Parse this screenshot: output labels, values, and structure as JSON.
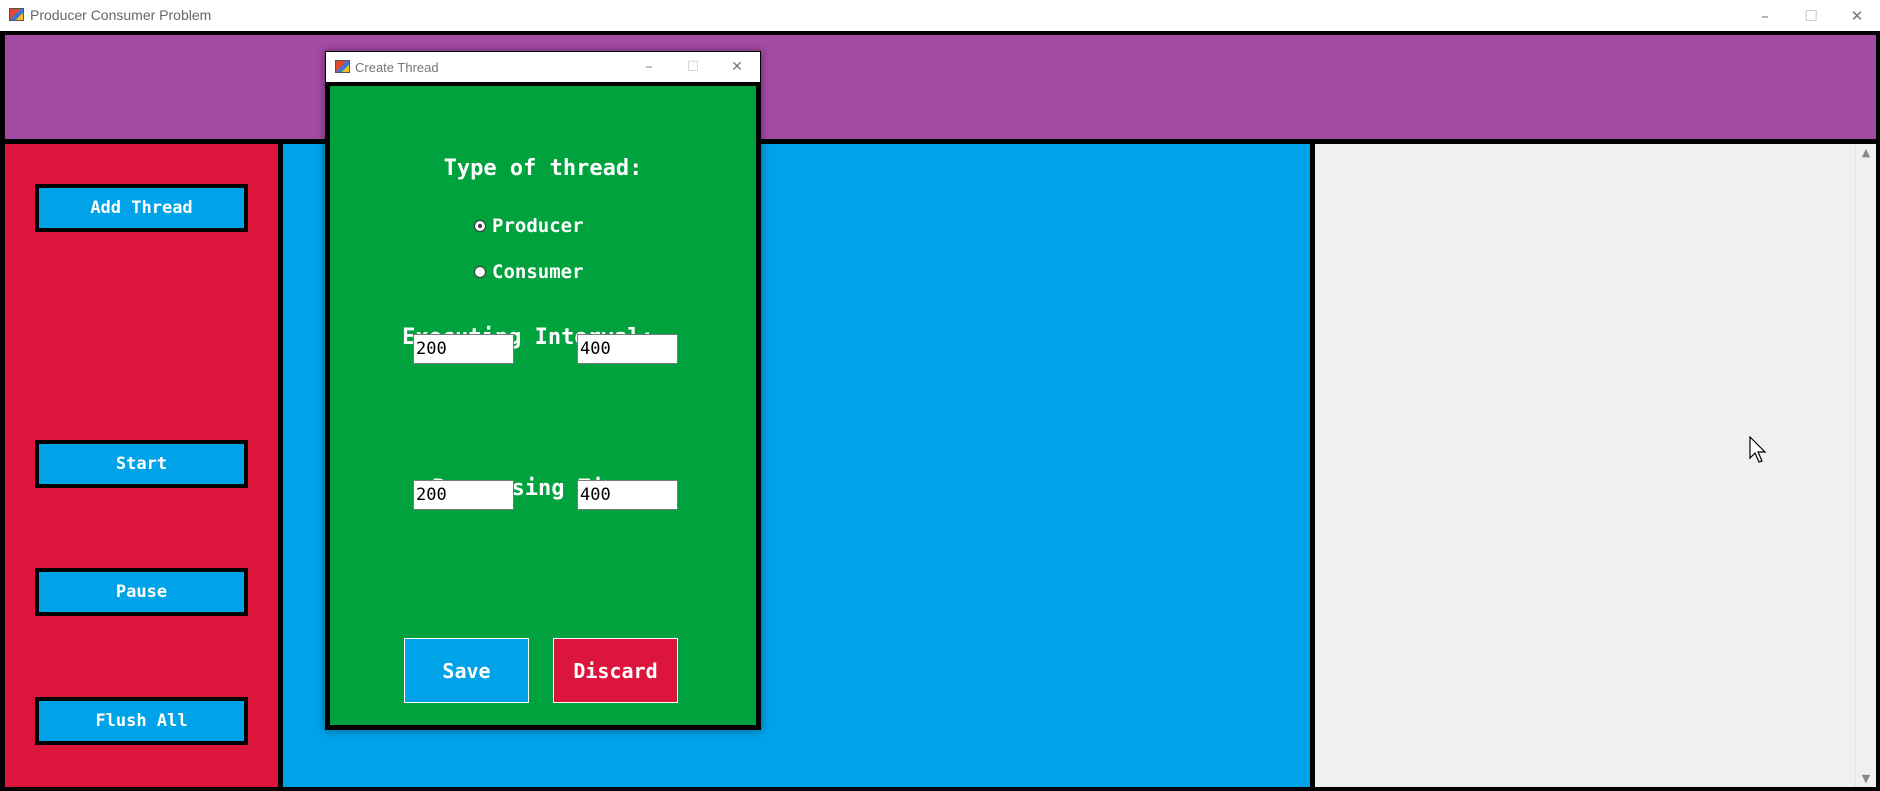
{
  "main_window": {
    "title": "Producer Consumer Problem",
    "controls": {
      "minimize": "–",
      "maximize": "☐",
      "close": "✕"
    }
  },
  "sidebar": {
    "add_thread": "Add Thread",
    "start": "Start",
    "pause": "Pause",
    "flush_all": "Flush All"
  },
  "dialog": {
    "title": "Create Thread",
    "controls": {
      "minimize": "–",
      "maximize": "☐",
      "close": "✕"
    },
    "type_heading": "Type of thread:",
    "producer_label": "Producer",
    "consumer_label": "Consumer",
    "selected_type": "Producer",
    "interval_heading": "Executing Interval:",
    "interval_min": "200",
    "interval_max": "400",
    "processing_heading": "Processing Time:",
    "processing_min": "200",
    "processing_max": "400",
    "save_label": "Save",
    "discard_label": "Discard"
  },
  "colors": {
    "header": "#a34aa5",
    "sidebar": "#dc153d",
    "workspace": "#00a2e8",
    "dialog_body": "#00a23d",
    "save_button": "#00a2e8",
    "discard_button": "#dc153d"
  },
  "scrollbar": {
    "up": "▲",
    "down": "▼"
  }
}
